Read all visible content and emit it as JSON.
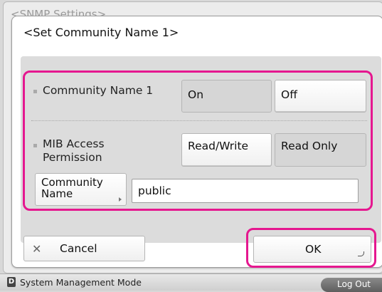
{
  "background_window": {
    "title": "<SNMP Settings>"
  },
  "dialog": {
    "title": "<Set Community Name 1>",
    "community_name_1": {
      "label": "Community Name 1",
      "options": [
        "On",
        "Off"
      ],
      "selected": "On"
    },
    "mib_access": {
      "label_line1": "MIB Access",
      "label_line2": "Permission",
      "options": [
        "Read/Write",
        "Read Only"
      ],
      "selected": "Read Only"
    },
    "community_name": {
      "button_line1": "Community",
      "button_line2": "Name",
      "value": "public"
    },
    "cancel": {
      "icon": "close-icon",
      "label": "Cancel"
    },
    "ok": {
      "label": "OK",
      "icon": "return-corner-icon"
    }
  },
  "statusbar": {
    "icon_letter": "D",
    "mode": "System Management Mode",
    "logout_label": "Log Out"
  },
  "colors": {
    "highlight": "#e5178f"
  }
}
